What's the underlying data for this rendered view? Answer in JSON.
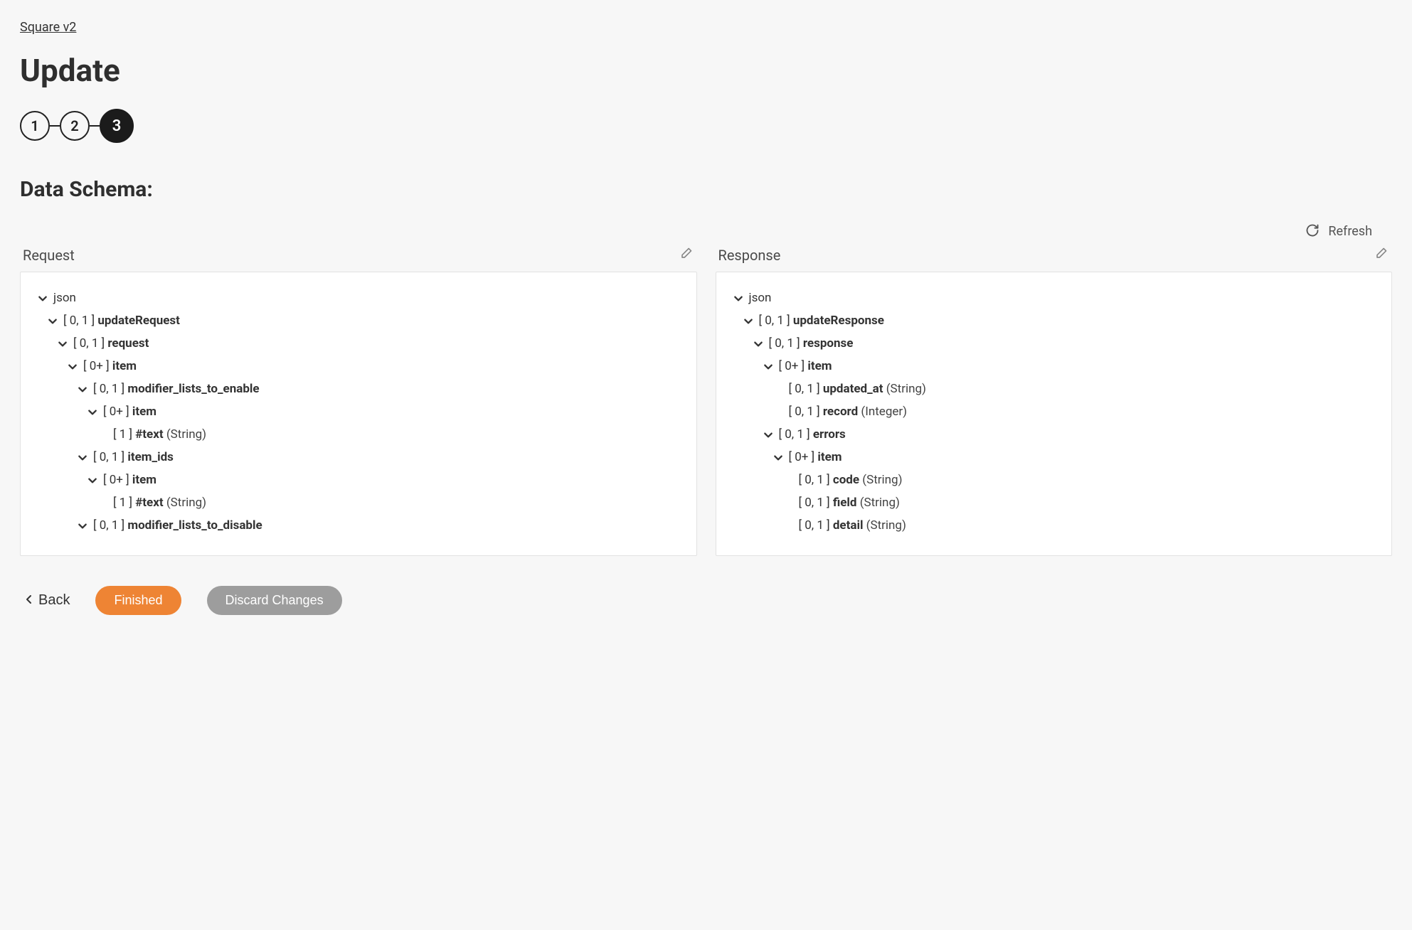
{
  "breadcrumb": {
    "label": "Square v2"
  },
  "page": {
    "title": "Update"
  },
  "stepper": {
    "steps": [
      "1",
      "2",
      "3"
    ],
    "active_index": 2
  },
  "section": {
    "heading": "Data Schema:"
  },
  "refresh": {
    "label": "Refresh"
  },
  "panels": {
    "request": {
      "title": "Request",
      "tree": [
        {
          "depth": 0,
          "expandable": true,
          "cardinality": "",
          "name": "json",
          "bold": false,
          "type": ""
        },
        {
          "depth": 1,
          "expandable": true,
          "cardinality": "[ 0, 1 ]",
          "name": "updateRequest",
          "bold": true,
          "type": ""
        },
        {
          "depth": 2,
          "expandable": true,
          "cardinality": "[ 0, 1 ]",
          "name": "request",
          "bold": true,
          "type": ""
        },
        {
          "depth": 3,
          "expandable": true,
          "cardinality": "[ 0+ ]",
          "name": "item",
          "bold": true,
          "type": ""
        },
        {
          "depth": 4,
          "expandable": true,
          "cardinality": "[ 0, 1 ]",
          "name": "modifier_lists_to_enable",
          "bold": true,
          "type": ""
        },
        {
          "depth": 5,
          "expandable": true,
          "cardinality": "[ 0+ ]",
          "name": "item",
          "bold": true,
          "type": ""
        },
        {
          "depth": 6,
          "expandable": false,
          "cardinality": "[ 1 ]",
          "name": "#text",
          "bold": true,
          "type": "(String)"
        },
        {
          "depth": 4,
          "expandable": true,
          "cardinality": "[ 0, 1 ]",
          "name": "item_ids",
          "bold": true,
          "type": ""
        },
        {
          "depth": 5,
          "expandable": true,
          "cardinality": "[ 0+ ]",
          "name": "item",
          "bold": true,
          "type": ""
        },
        {
          "depth": 6,
          "expandable": false,
          "cardinality": "[ 1 ]",
          "name": "#text",
          "bold": true,
          "type": "(String)"
        },
        {
          "depth": 4,
          "expandable": true,
          "cardinality": "[ 0, 1 ]",
          "name": "modifier_lists_to_disable",
          "bold": true,
          "type": ""
        }
      ]
    },
    "response": {
      "title": "Response",
      "tree": [
        {
          "depth": 0,
          "expandable": true,
          "cardinality": "",
          "name": "json",
          "bold": false,
          "type": ""
        },
        {
          "depth": 1,
          "expandable": true,
          "cardinality": "[ 0, 1 ]",
          "name": "updateResponse",
          "bold": true,
          "type": ""
        },
        {
          "depth": 2,
          "expandable": true,
          "cardinality": "[ 0, 1 ]",
          "name": "response",
          "bold": true,
          "type": ""
        },
        {
          "depth": 3,
          "expandable": true,
          "cardinality": "[ 0+ ]",
          "name": "item",
          "bold": true,
          "type": ""
        },
        {
          "depth": 4,
          "expandable": false,
          "cardinality": "[ 0, 1 ]",
          "name": "updated_at",
          "bold": true,
          "type": "(String)"
        },
        {
          "depth": 4,
          "expandable": false,
          "cardinality": "[ 0, 1 ]",
          "name": "record",
          "bold": true,
          "type": "(Integer)"
        },
        {
          "depth": 3,
          "expandable": true,
          "cardinality": "[ 0, 1 ]",
          "name": "errors",
          "bold": true,
          "type": ""
        },
        {
          "depth": 4,
          "expandable": true,
          "cardinality": "[ 0+ ]",
          "name": "item",
          "bold": true,
          "type": ""
        },
        {
          "depth": 5,
          "expandable": false,
          "cardinality": "[ 0, 1 ]",
          "name": "code",
          "bold": true,
          "type": "(String)"
        },
        {
          "depth": 5,
          "expandable": false,
          "cardinality": "[ 0, 1 ]",
          "name": "field",
          "bold": true,
          "type": "(String)"
        },
        {
          "depth": 5,
          "expandable": false,
          "cardinality": "[ 0, 1 ]",
          "name": "detail",
          "bold": true,
          "type": "(String)"
        }
      ]
    }
  },
  "footer": {
    "back_label": "Back",
    "finished_label": "Finished",
    "discard_label": "Discard Changes"
  }
}
